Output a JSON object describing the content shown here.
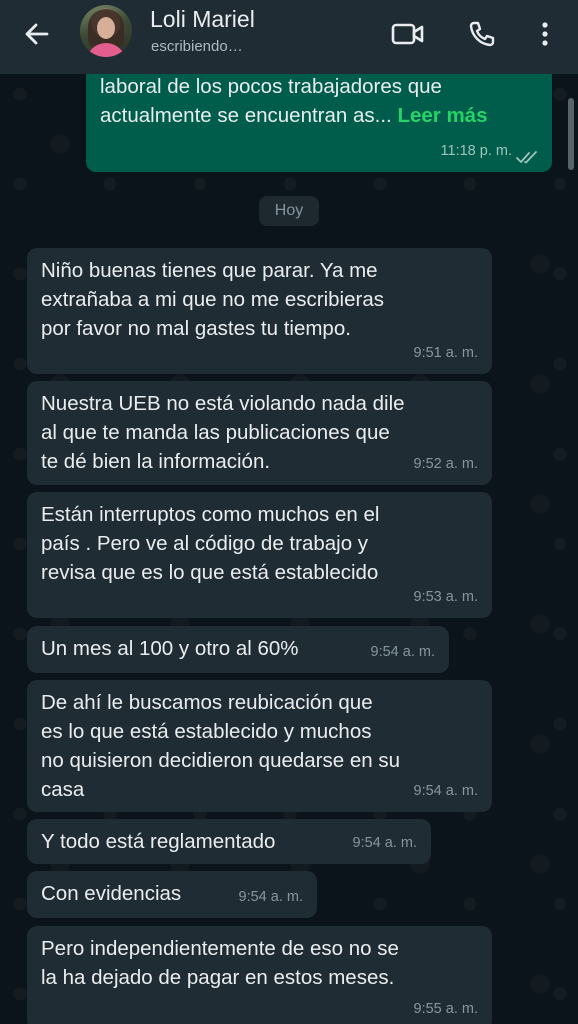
{
  "header": {
    "contact_name": "Loli Mariel",
    "status": "escribiendo…",
    "icons": [
      "back-arrow-icon",
      "video-call-icon",
      "phone-icon",
      "more-options-icon"
    ]
  },
  "chat": {
    "outgoing_preview": {
      "line1": "laboral de los pocos trabajadores que",
      "line2": "actualmente se encuentran as...",
      "read_more": "Leer más",
      "time": "11:18 p. m."
    },
    "day_label": "Hoy",
    "messages": [
      {
        "text": "Niño buenas tienes que parar. Ya me\nextrañaba a mi que no me escribieras\npor favor no mal gastes tu tiempo.",
        "time": "9:51 a. m."
      },
      {
        "text": "Nuestra UEB no está violando nada dile\nal que te manda las publicaciones que\nte dé bien la información.",
        "time": "9:52 a. m."
      },
      {
        "text": "Están interruptos como muchos en el\npaís . Pero ve al código de trabajo y\nrevisa que es lo que está establecido",
        "time": "9:53 a. m."
      },
      {
        "text": "Un mes al 100 y otro al 60%",
        "time": "9:54 a. m."
      },
      {
        "text": "De ahí le buscamos reubicación  que\nes lo que está establecido y muchos\nno quisieron decidieron quedarse en su\ncasa",
        "time": "9:54 a. m."
      },
      {
        "text": "Y todo está reglamentado",
        "time": "9:54 a. m."
      },
      {
        "text": "Con evidencias",
        "time": "9:54 a. m."
      },
      {
        "text": "Pero independientemente de eso no se\nla ha dejado de pagar en estos meses.",
        "time": "9:55 a. m."
      }
    ]
  },
  "colors": {
    "header_bg": "#1f2c34",
    "chat_bg": "#0b141a",
    "incoming_bubble": "#202c33",
    "outgoing_bubble": "#005c4b",
    "read_ticks": "#9fc4bb"
  }
}
